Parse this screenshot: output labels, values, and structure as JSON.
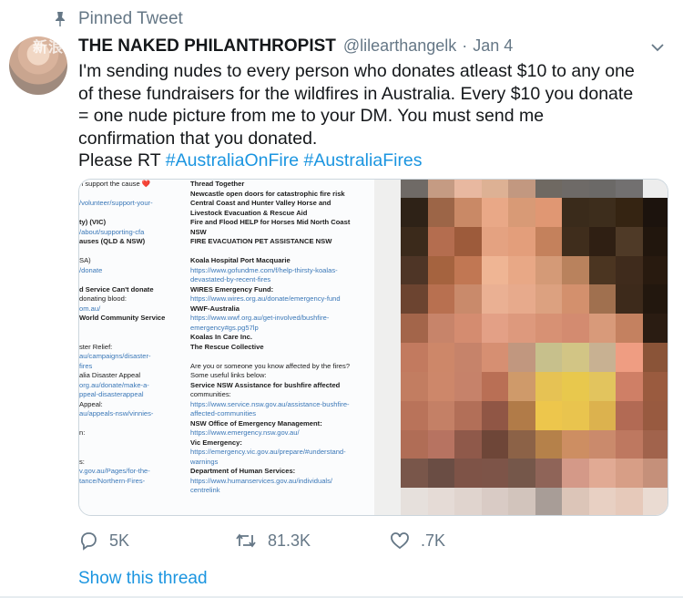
{
  "pinned_label": "Pinned Tweet",
  "avatar_watermark": "新浪",
  "author": {
    "display_name": "THE NAKED PHILANTHROPIST",
    "handle": "@lilearthangelk",
    "separator": "·",
    "date": "Jan 4"
  },
  "tweet": {
    "lines": [
      "I'm sending nudes to every person who donates atleast $10 to any one",
      "of these fundraisers for the wildfires in Australia. Every $10 you donate",
      "= one nude picture from me to your DM. You must send me",
      "confirmation that you donated."
    ],
    "last_line_prefix": "Please RT ",
    "hashtags": [
      "#AustraliaOnFire",
      "#AustraliaFires"
    ]
  },
  "media_left": {
    "left_col": [
      "n support the cause ❤️",
      "",
      "/volunteer/support-your-",
      "",
      "ty) (VIC)",
      "/about/supporting-cfa",
      "auses (QLD & NSW)",
      "",
      "SA)",
      "/donate",
      "",
      "d Service Can't donate",
      "donating blood:",
      "om.au/",
      " World Community Service",
      "",
      "",
      "ster Relief:",
      "au/campaigns/disaster-",
      "fires",
      "alia Disaster Appeal",
      "org.au/donate/make-a-",
      "ppeal-disasterappeal",
      "Appeal:",
      "au/appeals-nsw/vinnies-",
      "",
      "n:",
      "",
      "",
      "s:",
      "v.gov.au/Pages/for-the-",
      "tance/Northern-Fires-"
    ],
    "right_col": [
      "Thread Together",
      "Newcastle open doors for catastrophic fire risk",
      "Central Coast and Hunter Valley Horse and",
      "Livestock Evacuation & Rescue Aid",
      "Fire and Flood HELP for Horses Mid North Coast",
      "NSW",
      "FIRE EVACUATION PET ASSISTANCE NSW",
      "",
      "Koala Hospital Port Macquarie",
      "https://www.gofundme.com/f/help-thirsty-koalas-",
      "devastated-by-recent-fires",
      "WIRES Emergency Fund:",
      "https://www.wires.org.au/donate/emergency-fund",
      "WWF-Australia",
      "https://www.wwf.org.au/get-involved/bushfire-",
      "emergency#gs.pg57lp",
      "Koalas In Care Inc.",
      "The Rescue Collective",
      "",
      "Are you or someone you know affected by the fires?",
      "Some useful links below:",
      "Service NSW Assistance for bushfire affected",
      "communities:",
      "https://www.service.nsw.gov.au/assistance-bushfire-",
      "affected-communities",
      "NSW Office of Emergency Management:",
      "https://www.emergency.nsw.gov.au/",
      "Vic Emergency:",
      "https://emergency.vic.gov.au/prepare/#understand-",
      "warnings",
      "Department of Human Services:",
      "https://www.humanservices.gov.au/individuals/",
      "centrelink"
    ],
    "right_bold_rows": [
      0,
      1,
      2,
      3,
      4,
      5,
      6,
      8,
      11,
      13,
      16,
      17,
      21,
      25,
      27,
      30
    ],
    "right_link_rows": [
      9,
      10,
      12,
      14,
      15,
      23,
      24,
      26,
      28,
      29,
      31,
      32
    ],
    "left_bold_rows": [
      4,
      6,
      11,
      14
    ],
    "left_link_rows": [
      2,
      5,
      9,
      13,
      18,
      19,
      21,
      22,
      24,
      30,
      31
    ]
  },
  "pixel_colors": [
    [
      "#efefee",
      "#6f6a66",
      "#c59b83",
      "#e8b8a0",
      "#ddb194",
      "#c29880",
      "#6f6962",
      "#6e6a67",
      "#6b6967",
      "#727070",
      "#ededed"
    ],
    [
      "#efefee",
      "#2e2217",
      "#9c6547",
      "#c98966",
      "#e9a887",
      "#d89a76",
      "#e09773",
      "#3a2b1b",
      "#3d2d1c",
      "#352412",
      "#1c130d"
    ],
    [
      "#efefee",
      "#3b2a1b",
      "#b46d4f",
      "#9d5b3b",
      "#e4a281",
      "#e39e7b",
      "#c4815c",
      "#3f2d1c",
      "#2f1f13",
      "#4f3a27",
      "#21160d"
    ],
    [
      "#efefee",
      "#4e3526",
      "#a5633f",
      "#c17753",
      "#efb594",
      "#e8a886",
      "#d49a77",
      "#b9825d",
      "#4b3521",
      "#3f2b1c",
      "#281a0f"
    ],
    [
      "#efefee",
      "#6c4430",
      "#b87050",
      "#c98a6b",
      "#eab093",
      "#e7aa8c",
      "#dca180",
      "#d3906d",
      "#a0704f",
      "#3d2a1b",
      "#22170e"
    ],
    [
      "#efefee",
      "#a3654a",
      "#c7846a",
      "#d48c70",
      "#e3a086",
      "#dd997d",
      "#d79174",
      "#d38b70",
      "#d89a7a",
      "#c48160",
      "#2a1c12"
    ],
    [
      "#efefee",
      "#c27a5f",
      "#cd8769",
      "#c6836a",
      "#d68f72",
      "#c1977f",
      "#c7c08c",
      "#d2c585",
      "#c8b192",
      "#ef9d82",
      "#8a5438"
    ],
    [
      "#efefee",
      "#c27d61",
      "#cd876a",
      "#c6826a",
      "#b96f55",
      "#cf9a6a",
      "#e6c254",
      "#e8c84d",
      "#e2c45e",
      "#cf7f66",
      "#9a5b3f"
    ],
    [
      "#efefee",
      "#b9735a",
      "#c48066",
      "#b26f58",
      "#905645",
      "#b17b48",
      "#edc64c",
      "#e9c44e",
      "#dcb24e",
      "#b26a54",
      "#985a40"
    ],
    [
      "#efefee",
      "#b06d56",
      "#b77361",
      "#8f594a",
      "#6e4638",
      "#8c6247",
      "#b5814a",
      "#cd8e62",
      "#ca8a6c",
      "#be7860",
      "#a1634c"
    ],
    [
      "#efefee",
      "#79564a",
      "#6a4d44",
      "#7e5347",
      "#7d5448",
      "#75574a",
      "#8f6458",
      "#d49988",
      "#e1aa94",
      "#d79e86",
      "#c5907a"
    ],
    [
      "#efefee",
      "#e6e0dc",
      "#e5dbd6",
      "#e0d4ce",
      "#d9cbc5",
      "#d2c4bc",
      "#a89d97",
      "#dcc5b8",
      "#e8d0c3",
      "#e6c9ba",
      "#eadbd2"
    ]
  ],
  "actions": {
    "reply_count": "5K",
    "retweet_count": "81.3K",
    "like_count": ".7K"
  },
  "show_thread_label": "Show this thread"
}
